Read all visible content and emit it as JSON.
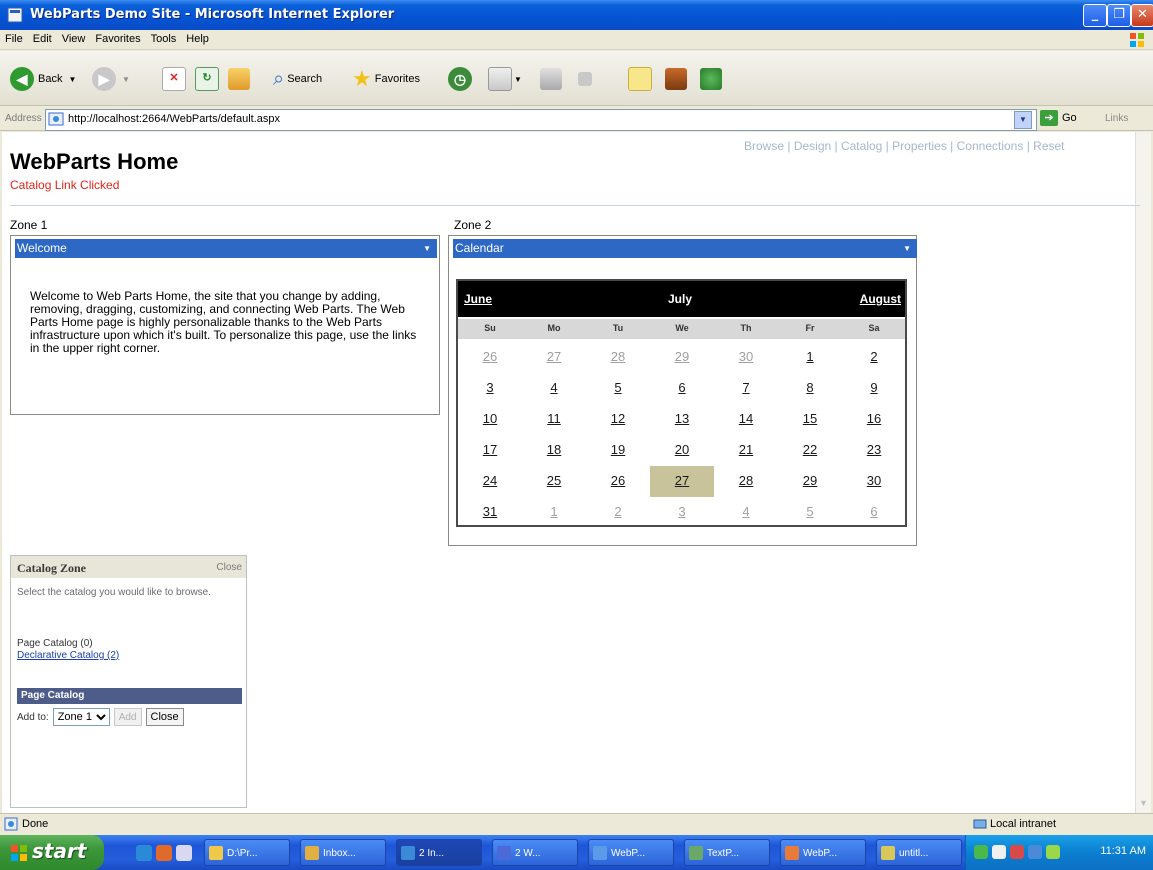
{
  "window": {
    "title": "WebParts Demo Site - Microsoft Internet Explorer"
  },
  "menu": [
    "File",
    "Edit",
    "View",
    "Favorites",
    "Tools",
    "Help"
  ],
  "toolbar": {
    "back_label": "Back",
    "search_label": "Search",
    "favorites_label": "Favorites"
  },
  "address": {
    "label": "Address",
    "url": "http://localhost:2664/WebParts/default.aspx",
    "go_label": "Go",
    "links_label": "Links"
  },
  "page": {
    "title": "WebParts Home",
    "status": "Catalog Link Clicked",
    "mode_links": [
      "Browse",
      "Design",
      "Catalog",
      "Properties",
      "Connections",
      "Reset"
    ]
  },
  "zone1": {
    "label": "Zone 1",
    "part_title": "Welcome",
    "text": "Welcome to Web Parts Home, the site that you change by adding, removing, dragging, customizing, and connecting Web Parts. The Web Parts Home page is highly personalizable thanks to the Web Parts infrastructure upon which it's built. To personalize this page, use the links in the upper right corner."
  },
  "zone2": {
    "label": "Zone 2",
    "part_title": "Calendar",
    "calendar": {
      "prev_month": "June",
      "month": "July",
      "next_month": "August",
      "day_headers": [
        "Su",
        "Mo",
        "Tu",
        "We",
        "Th",
        "Fr",
        "Sa"
      ],
      "weeks": [
        [
          "26",
          "27",
          "28",
          "29",
          "30",
          "1",
          "2"
        ],
        [
          "3",
          "4",
          "5",
          "6",
          "7",
          "8",
          "9"
        ],
        [
          "10",
          "11",
          "12",
          "13",
          "14",
          "15",
          "16"
        ],
        [
          "17",
          "18",
          "19",
          "20",
          "21",
          "22",
          "23"
        ],
        [
          "24",
          "25",
          "26",
          "27",
          "28",
          "29",
          "30"
        ],
        [
          "31",
          "1",
          "2",
          "3",
          "4",
          "5",
          "6"
        ]
      ],
      "selected": "27"
    }
  },
  "catalog_zone": {
    "title": "Catalog Zone",
    "close_link": "Close",
    "instructions": "Select the catalog you would like to browse.",
    "page_catalog": "Page Catalog (0)",
    "declarative_catalog": "Declarative Catalog (2)",
    "selected_catalog_header": "Page Catalog",
    "add_to_label": "Add to:",
    "zone_select_value": "Zone 1",
    "add_button": "Add",
    "close_button": "Close"
  },
  "statusbar": {
    "status": "Done",
    "zone": "Local intranet"
  },
  "taskbar": {
    "start": "start",
    "buttons": [
      "D:\\Pr...",
      "Inbox...",
      "2 In...",
      "2 W...",
      "WebP...",
      "TextP...",
      "WebP...",
      "untitl..."
    ],
    "clock": "11:31 AM"
  }
}
